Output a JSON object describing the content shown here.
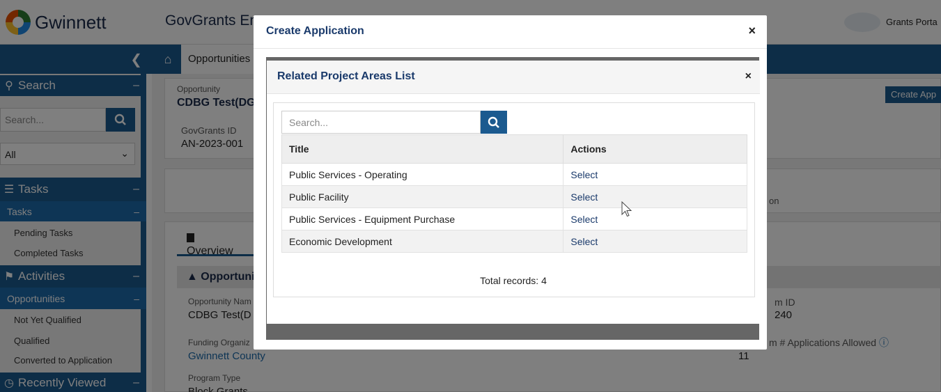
{
  "header": {
    "brand": "Gwinnett",
    "app_title": "GovGrants Ent",
    "portal_link": "Grants Porta"
  },
  "sidebar": {
    "search_section": "Search",
    "search_placeholder": "Search...",
    "filter_value": "All",
    "tasks_section": "Tasks",
    "tasks_sub": "Tasks",
    "tasks_items": [
      "Pending Tasks",
      "Completed Tasks"
    ],
    "activities_section": "Activities",
    "opportunities_sub": "Opportunities",
    "opportunities_items": [
      "Not Yet Qualified",
      "Qualified",
      "Converted to Application"
    ],
    "recent_section": "Recently Viewed",
    "collapse_dash": "–"
  },
  "breadcrumb": {
    "current": "Opportunities"
  },
  "page": {
    "opportunity_label": "Opportunity",
    "opportunity_title": "CDBG Test(DG",
    "govgrants_id_label": "GovGrants ID",
    "govgrants_id_value": "AN-2023-001",
    "create_app_button": "Create App",
    "card2_text": "on",
    "tab_overview": "Overview",
    "section_title": "▲ Opportuni",
    "opp_name_label": "Opportunity Nam",
    "opp_name_value": "CDBG Test(D",
    "funding_org_label": "Funding Organiz",
    "funding_org_value": "Gwinnett County",
    "program_type_label": "Program Type",
    "program_type_value": "Block Grants",
    "right_id_label": "m ID",
    "right_id_value": "240",
    "right_max_label": "m # Applications Allowed",
    "right_max_value": "11"
  },
  "modal_outer": {
    "title": "Create Application",
    "close": "×"
  },
  "modal_inner": {
    "title": "Related Project Areas List",
    "close": "×",
    "search_placeholder": "Search...",
    "columns": [
      "Title",
      "Actions"
    ],
    "rows": [
      {
        "title": "Public Services - Operating",
        "action": "Select"
      },
      {
        "title": "Public Facility",
        "action": "Select"
      },
      {
        "title": "Public Services - Equipment Purchase",
        "action": "Select"
      },
      {
        "title": "Economic Development",
        "action": "Select"
      }
    ],
    "total_records": "Total records: 4"
  },
  "colors": {
    "brand_blue": "#1b5a8f",
    "title_navy": "#1a3a6b",
    "link_blue": "#1d6bab"
  }
}
